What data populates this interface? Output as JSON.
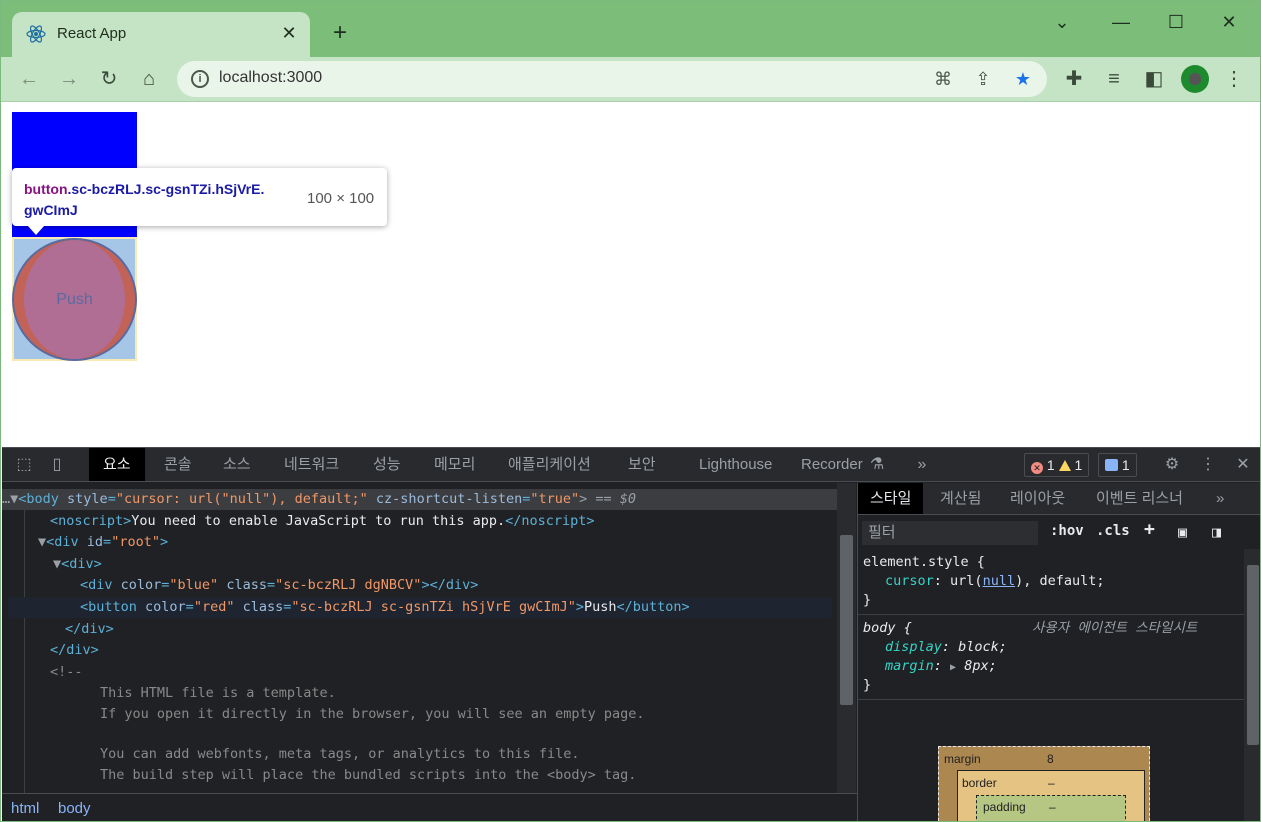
{
  "browser": {
    "tab_title": "React App",
    "tab_close": "✕",
    "new_tab": "+",
    "url": "localhost:3000",
    "window_controls": {
      "dropdown": "⌄",
      "minimize": "—",
      "maximize": "☐",
      "close": "✕"
    }
  },
  "page": {
    "button_label": "Push",
    "tooltip": {
      "tag": "button",
      "classes": ".sc-bczRLJ.sc-gsnTZi.hSjVrE.",
      "classes_line2": "gwCImJ",
      "dimensions": "100 × 100"
    },
    "colors": {
      "box": "#0000ff",
      "button": "#c8503c"
    }
  },
  "devtools": {
    "tabs": [
      "요소",
      "콘솔",
      "소스",
      "네트워크",
      "성능",
      "메모리",
      "애플리케이션",
      "보안",
      "Lighthouse",
      "Recorder"
    ],
    "more": "»",
    "errors": "1",
    "warnings": "1",
    "messages": "1",
    "elements_lines": [
      {
        "pre": "…▼",
        "tag_open": "<body ",
        "attr1": "style",
        "val1": "\"cursor: url(\"null\"), default;\"",
        "attr2": " cz-shortcut-listen",
        "val2": "\"true\"",
        "tail": "> == $0"
      },
      {
        "text_a": "<noscript>",
        "text_b": "You need to enable JavaScript to run this app.",
        "text_c": "</noscript>"
      },
      {
        "text_a": "▼",
        "text_b": "<div ",
        "attr": "id",
        "val": "\"root\"",
        "text_c": ">"
      },
      {
        "text_a": "▼",
        "text_b": "<div>"
      },
      {
        "text_a": "<div ",
        "attr1": "color",
        "val1": "\"blue\"",
        "attr2": " class",
        "val2": "\"sc-bczRLJ dgNBCV\"",
        "text_c": "></div>"
      },
      {
        "text_a": "<button ",
        "attr1": "color",
        "val1": "\"red\"",
        "attr2": " class",
        "val2": "\"sc-bczRLJ sc-gsnTZi hSjVrE gwCImJ\"",
        "text_b": ">",
        "text_c": "Push",
        "text_d": "</button>"
      },
      {
        "text": "</div>"
      },
      {
        "text": "</div>"
      },
      {
        "text": "<!--"
      },
      {
        "text": "This HTML file is a template."
      },
      {
        "text": "If you open it directly in the browser, you will see an empty page."
      },
      {
        "text": "You can add webfonts, meta tags, or analytics to this file."
      },
      {
        "text": "The build step will place the bundled scripts into the <body> tag."
      }
    ],
    "breadcrumbs": [
      "html",
      "body"
    ],
    "styles_tabs": [
      "스타일",
      "계산됨",
      "레이아웃",
      "이벤트 리스너"
    ],
    "filter_placeholder": "필터",
    "hov": ":hov",
    "cls": ".cls",
    "add": "+",
    "rules": {
      "element_style": {
        "selector": "element.style",
        "prop": "cursor",
        "value_pre": "url(",
        "value_link": "null",
        "value_post": "), default;"
      },
      "body": {
        "selector": "body",
        "source": "사용자 에이전트 스타일시트",
        "p1": "display",
        "v1": "block;",
        "p2": "margin",
        "v2": "8px;"
      }
    },
    "box_model": {
      "margin_label": "margin",
      "margin_val": "8",
      "border_label": "border",
      "border_val": "–",
      "padding_label": "padding",
      "padding_val": "–"
    }
  }
}
